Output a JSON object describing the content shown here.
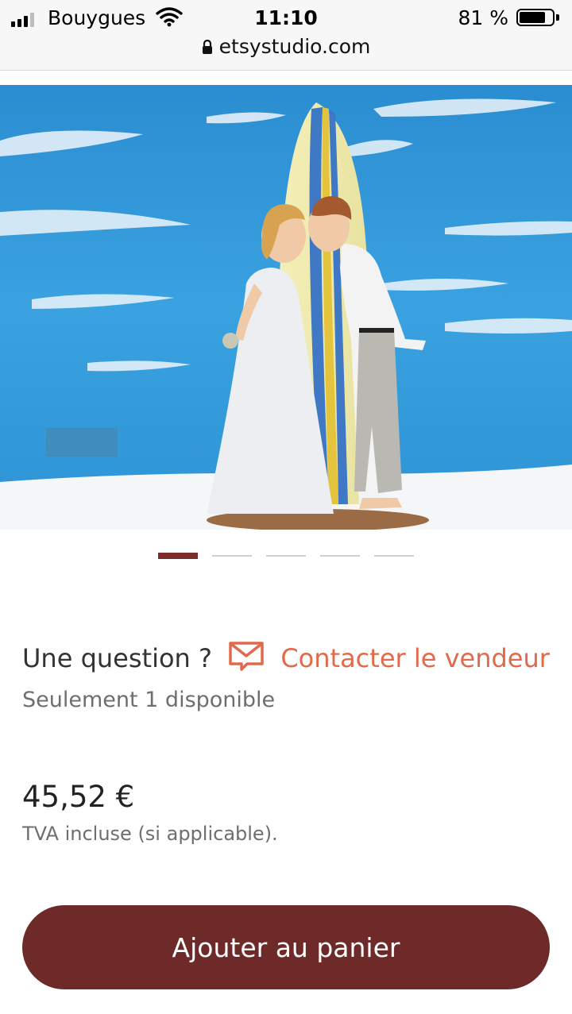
{
  "status_bar": {
    "carrier": "Bouygues",
    "time": "11:10",
    "battery_percent": "81 %",
    "battery_level": 0.81,
    "url": "etsystudio.com"
  },
  "icons": {
    "signal": "cellular-signal-icon",
    "wifi": "wifi-icon",
    "battery": "battery-icon",
    "lock": "lock-icon",
    "mail": "mail-icon"
  },
  "carousel": {
    "count": 5,
    "active_index": 0
  },
  "product": {
    "question_label": "Une question ?",
    "contact_label": "Contacter le vendeur",
    "stock_text": "Seulement 1 disponible",
    "price": "45,52 €",
    "vat_text": "TVA incluse (si applicable)."
  },
  "actions": {
    "add_to_cart_label": "Ajouter au panier"
  },
  "colors": {
    "accent": "#6e2a28",
    "link": "#e06a4b",
    "active_dot": "#7a2d2b"
  }
}
